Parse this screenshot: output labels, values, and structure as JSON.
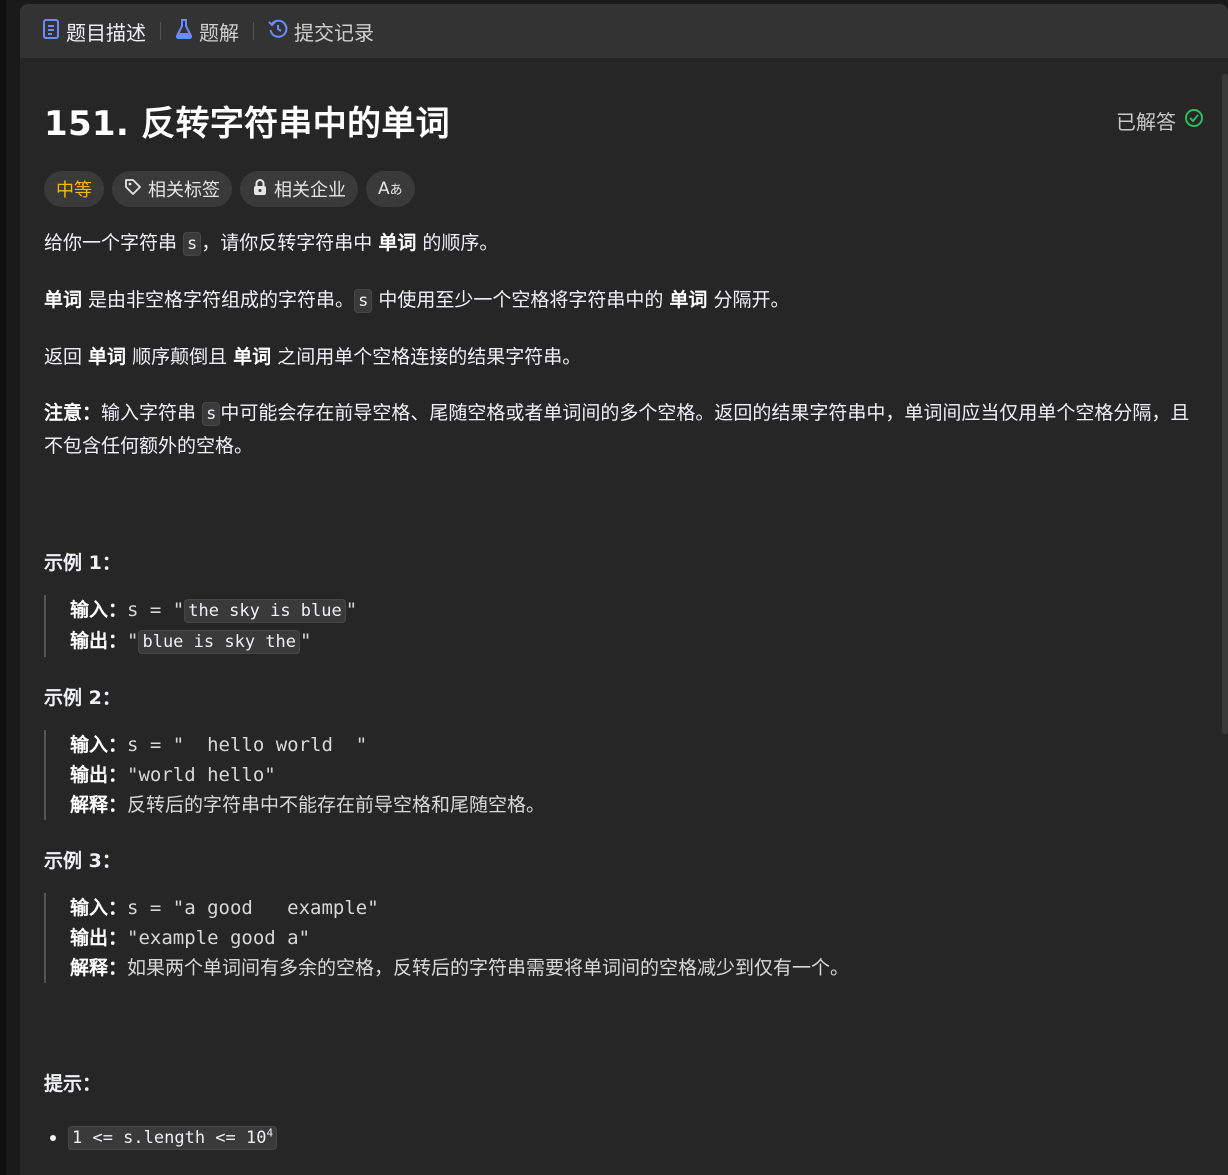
{
  "tabs": {
    "description": "题目描述",
    "solutions": "题解",
    "submissions": "提交记录"
  },
  "problem": {
    "title": "151. 反转字符串中的单词",
    "status": "已解答",
    "tags": {
      "difficulty": "中等",
      "topics": "相关标签",
      "companies": "相关企业",
      "font": "Aあ"
    }
  },
  "description": {
    "p1": {
      "a": "给你一个字符串 ",
      "code": "s",
      "b": "，请你反转字符串中 ",
      "bold": "单词",
      "c": " 的顺序。"
    },
    "p2": {
      "bold1": "单词",
      "a": " 是由非空格字符组成的字符串。",
      "code": "s",
      "b": " 中使用至少一个空格将字符串中的 ",
      "bold2": "单词",
      "c": " 分隔开。"
    },
    "p3": {
      "a": "返回 ",
      "bold1": "单词",
      "b": " 顺序颠倒且 ",
      "bold2": "单词",
      "c": " 之间用单个空格连接的结果字符串。"
    },
    "p4": {
      "bold": "注意：",
      "a": "输入字符串 ",
      "code": "s",
      "b": "中可能会存在前导空格、尾随空格或者单词间的多个空格。返回的结果字符串中，单词间应当仅用单个空格分隔，且不包含任何额外的空格。"
    }
  },
  "examples": [
    {
      "title": "示例 1：",
      "input_label": "输入：",
      "input_prefix": "s = \"",
      "input_code": "the sky is blue",
      "input_suffix": "\"",
      "output_label": "输出：",
      "output_prefix": "\"",
      "output_code": "blue is sky the",
      "output_suffix": "\""
    },
    {
      "title": "示例 2：",
      "input_label": "输入：",
      "input": "s = \"  hello world  \"",
      "output_label": "输出：",
      "output": "\"world hello\"",
      "explain_label": "解释：",
      "explain": "反转后的字符串中不能存在前导空格和尾随空格。"
    },
    {
      "title": "示例 3：",
      "input_label": "输入：",
      "input": "s = \"a good   example\"",
      "output_label": "输出：",
      "output": "\"example good a\"",
      "explain_label": "解释：",
      "explain": "如果两个单词间有多余的空格，反转后的字符串需要将单词间的空格减少到仅有一个。"
    }
  ],
  "hints": {
    "title": "提示：",
    "items": [
      {
        "code": "1 <= s.length <= 10",
        "sup": "4"
      }
    ]
  },
  "colors": {
    "background": "#262626",
    "tabbar": "#333333",
    "difficulty_medium": "#ffb800",
    "solved_check": "#2cbb5d",
    "tab_icon": "#6a8cff"
  },
  "icons": [
    "description-icon",
    "flask-icon",
    "history-icon",
    "check-circle-icon",
    "tag-icon",
    "lock-icon",
    "translate-icon"
  ]
}
